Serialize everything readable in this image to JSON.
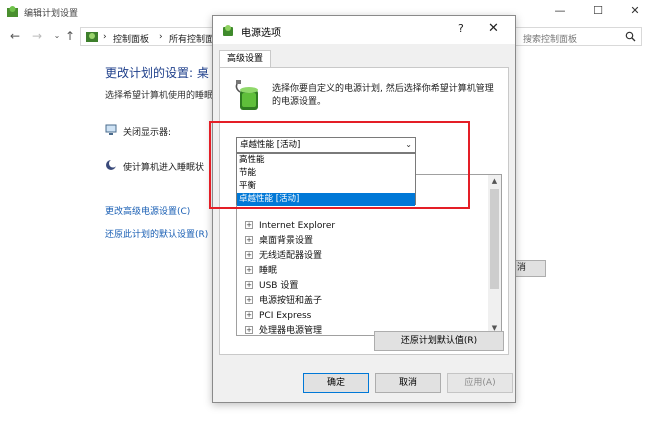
{
  "background_window": {
    "title": "编辑计划设置",
    "breadcrumb": [
      "控制面板",
      "所有控制面"
    ],
    "search_placeholder": "搜索控制面板",
    "heading": "更改计划的设置: 桌",
    "subtitle": "选择希望计算机使用的睡眠",
    "rows": [
      {
        "label": "关闭显示器:",
        "icon": "monitor-icon"
      },
      {
        "label": "使计算机进入睡眠状",
        "icon": "moon-icon"
      }
    ],
    "links": [
      "更改高级电源设置(C)",
      "还原此计划的默认设置(R)"
    ],
    "partial_button": "消"
  },
  "dialog": {
    "title": "电源选项",
    "help_label": "?",
    "close_label": "✕",
    "tab": "高级设置",
    "description": "选择你要自定义的电源计划, 然后选择你希望计算机管理的电源设置。",
    "plan_combo": {
      "selected": "卓越性能 [活动]",
      "options": [
        "高性能",
        "节能",
        "平衡",
        "卓越性能 [活动]"
      ],
      "highlighted_option": "卓越性能 [活动]"
    },
    "settings_tree": [
      "Internet Explorer",
      "桌面背景设置",
      "无线适配器设置",
      "睡眠",
      "USB 设置",
      "电源按钮和盖子",
      "PCI Express",
      "处理器电源管理"
    ],
    "restore_button": "还原计划默认值(R)",
    "ok_button": "确定",
    "cancel_button": "取消",
    "apply_button": "应用(A)"
  },
  "colors": {
    "accent": "#0078d7",
    "highlight_border": "#e41e26",
    "link": "#1a5fb4",
    "heading": "#1e3f8b"
  }
}
